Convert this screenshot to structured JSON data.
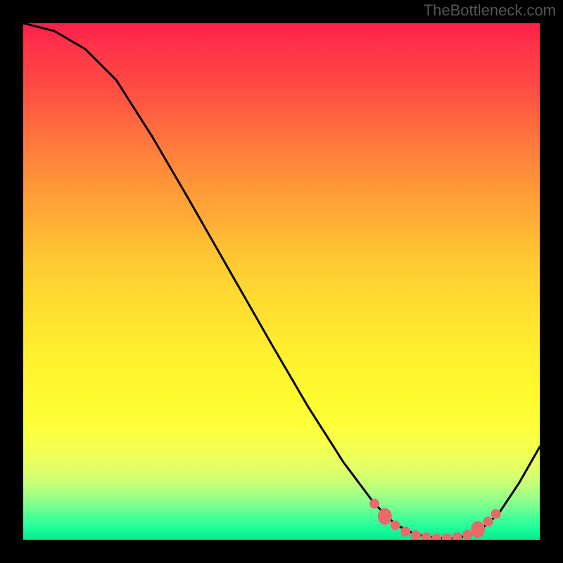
{
  "watermark": "TheBottleneck.com",
  "chart_data": {
    "type": "line",
    "title": "",
    "xlabel": "",
    "ylabel": "",
    "xlim": [
      0,
      100
    ],
    "ylim": [
      0,
      100
    ],
    "curve": [
      {
        "x": 0,
        "y": 100
      },
      {
        "x": 6,
        "y": 98.5
      },
      {
        "x": 12,
        "y": 95
      },
      {
        "x": 18,
        "y": 89
      },
      {
        "x": 25,
        "y": 78
      },
      {
        "x": 32,
        "y": 66
      },
      {
        "x": 40,
        "y": 52
      },
      {
        "x": 48,
        "y": 38
      },
      {
        "x": 55,
        "y": 26
      },
      {
        "x": 62,
        "y": 15
      },
      {
        "x": 68,
        "y": 7
      },
      {
        "x": 72,
        "y": 3
      },
      {
        "x": 76,
        "y": 1
      },
      {
        "x": 80,
        "y": 0.3
      },
      {
        "x": 84,
        "y": 0.3
      },
      {
        "x": 88,
        "y": 1.5
      },
      {
        "x": 92,
        "y": 5
      },
      {
        "x": 96,
        "y": 11
      },
      {
        "x": 100,
        "y": 18
      }
    ],
    "markers": [
      {
        "x": 68,
        "y": 7,
        "size": "small"
      },
      {
        "x": 70,
        "y": 4.5,
        "size": "large"
      },
      {
        "x": 72,
        "y": 2.8,
        "size": "small"
      },
      {
        "x": 74,
        "y": 1.6,
        "size": "small"
      },
      {
        "x": 76,
        "y": 0.9,
        "size": "small"
      },
      {
        "x": 78,
        "y": 0.5,
        "size": "small"
      },
      {
        "x": 80,
        "y": 0.3,
        "size": "small"
      },
      {
        "x": 82,
        "y": 0.3,
        "size": "small"
      },
      {
        "x": 84,
        "y": 0.5,
        "size": "small"
      },
      {
        "x": 86,
        "y": 1.0,
        "size": "small"
      },
      {
        "x": 88,
        "y": 2.0,
        "size": "large"
      },
      {
        "x": 90,
        "y": 3.5,
        "size": "small"
      },
      {
        "x": 91.5,
        "y": 5.0,
        "size": "small"
      }
    ],
    "marker_color": "#e86a6a",
    "curve_color": "#000000"
  }
}
